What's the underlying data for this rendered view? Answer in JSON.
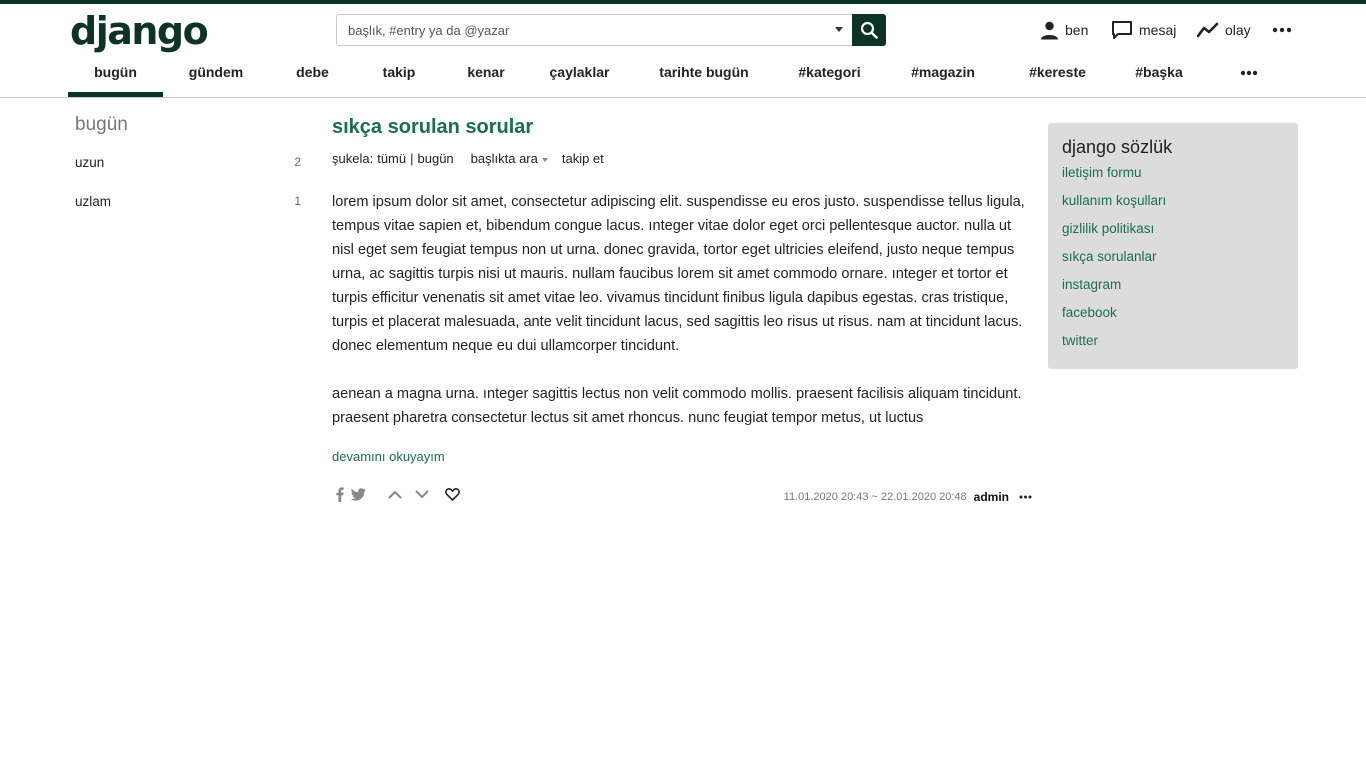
{
  "site": {
    "logo": "django"
  },
  "search": {
    "placeholder": "başlık, #entry ya da @yazar"
  },
  "userlinks": {
    "profile": "ben",
    "messages": "mesaj",
    "activity": "olay"
  },
  "nav": {
    "tabs": [
      {
        "label": "bugün",
        "active": true
      },
      {
        "label": "gündem"
      },
      {
        "label": "debe"
      },
      {
        "label": "takip"
      },
      {
        "label": "kenar"
      },
      {
        "label": "çaylaklar"
      },
      {
        "label": "tarihte bugün"
      },
      {
        "label": "#kategori"
      },
      {
        "label": "#magazin"
      },
      {
        "label": "#kereste"
      },
      {
        "label": "#başka"
      }
    ]
  },
  "left": {
    "title": "bugün",
    "items": [
      {
        "label": "uzun",
        "count": "2"
      },
      {
        "label": "uzlam",
        "count": "1"
      }
    ]
  },
  "topic": {
    "title": "sıkça sorulan sorular",
    "sukela_label": "şukela:",
    "sukela_all": "tümü",
    "sukela_sep": "|",
    "sukela_today": "bugün",
    "search_in_topic": "başlıkta ara",
    "follow": "takip et"
  },
  "entry": {
    "paragraphs": [
      "lorem ipsum dolor sit amet, consectetur adipiscing elit. suspendisse eu eros justo. suspendisse tellus ligula, tempus vitae sapien et, bibendum congue lacus. ınteger vitae dolor eget orci pellentesque auctor. nulla ut nisl eget sem feugiat tempus non ut urna. donec gravida, tortor eget ultricies eleifend, justo neque tempus urna, ac sagittis turpis nisi ut mauris. nullam faucibus lorem sit amet commodo ornare. ınteger et tortor et turpis efficitur venenatis sit amet vitae leo. vivamus tincidunt finibus ligula dapibus egestas. cras tristique, turpis et placerat malesuada, ante velit tincidunt lacus, sed sagittis leo risus ut risus. nam at tincidunt lacus. donec elementum neque eu dui ullamcorper tincidunt.",
      "aenean a magna urna. ınteger sagittis lectus non velit commodo mollis. praesent facilisis aliquam tincidunt. praesent pharetra consectetur lectus sit amet rhoncus. nunc feugiat tempor metus, ut luctus"
    ],
    "read_more": "devamını okuyayım",
    "date": "11.01.2020 20:43 ~ 22.01.2020 20:48",
    "author": "admin"
  },
  "right": {
    "title": "django sözlük",
    "links": [
      "iletişim formu",
      "kullanım koşulları",
      "gizlilik politikası",
      "sıkça sorulanlar",
      "instagram",
      "facebook",
      "twitter"
    ]
  },
  "colors": {
    "brand": "#0c3326",
    "link": "#1a6e4c",
    "panel": "#dcdcdc"
  },
  "icons": [
    "person-icon",
    "message-icon",
    "activity-icon",
    "more-icon",
    "search-icon",
    "facebook-icon",
    "twitter-icon",
    "upvote-icon",
    "downvote-icon",
    "favorite-icon"
  ]
}
